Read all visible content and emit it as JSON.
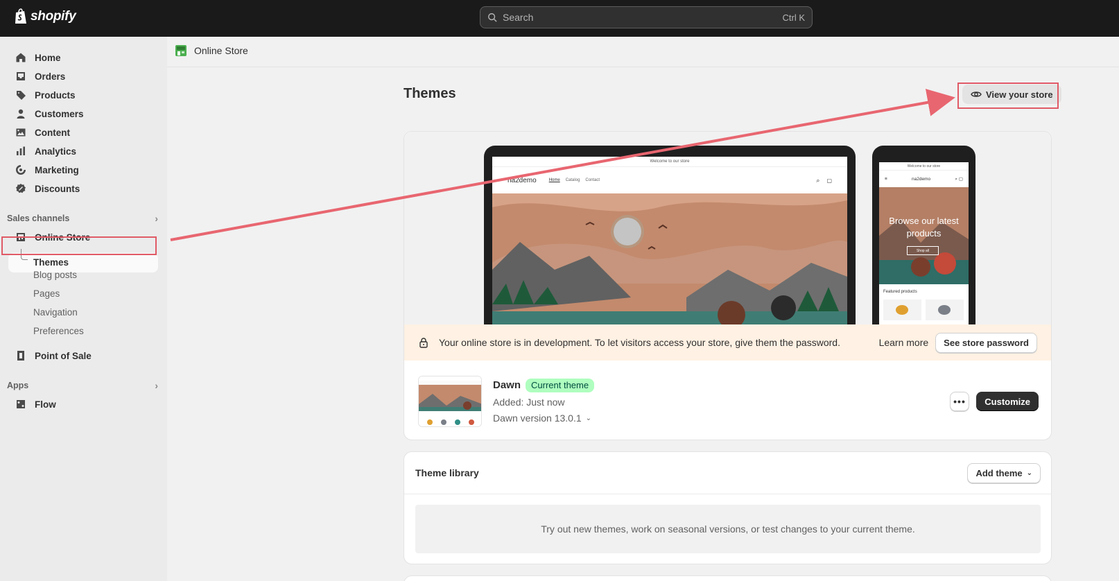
{
  "topbar": {
    "logo_text": "shopify",
    "search_placeholder": "Search",
    "search_shortcut": "Ctrl K"
  },
  "sidebar": {
    "items": [
      {
        "label": "Home",
        "icon": "home-icon"
      },
      {
        "label": "Orders",
        "icon": "inbox-icon"
      },
      {
        "label": "Products",
        "icon": "tag-icon"
      },
      {
        "label": "Customers",
        "icon": "person-icon"
      },
      {
        "label": "Content",
        "icon": "image-icon"
      },
      {
        "label": "Analytics",
        "icon": "bar-chart-icon"
      },
      {
        "label": "Marketing",
        "icon": "target-icon"
      },
      {
        "label": "Discounts",
        "icon": "discount-icon"
      }
    ],
    "sales_channels_label": "Sales channels",
    "online_store_label": "Online Store",
    "online_store_sub": [
      "Themes",
      "Blog posts",
      "Pages",
      "Navigation",
      "Preferences"
    ],
    "point_of_sale_label": "Point of Sale",
    "apps_label": "Apps",
    "flow_label": "Flow"
  },
  "breadcrumb": {
    "label": "Online Store"
  },
  "page": {
    "title": "Themes",
    "view_store_label": "View your store"
  },
  "preview": {
    "laptop": {
      "announcement": "Welcome to our store",
      "store_name": "na2demo",
      "nav": [
        "Home",
        "Catalog",
        "Contact"
      ]
    },
    "phone": {
      "announcement": "Welcome to our store",
      "store_name": "na2demo",
      "hero_text": "Browse our latest products",
      "hero_button": "Shop all",
      "featured_label": "Featured products"
    }
  },
  "notice": {
    "text": "Your online store is in development. To let visitors access your store, give them the password.",
    "learn_more": "Learn more",
    "button": "See store password"
  },
  "current_theme": {
    "name": "Dawn",
    "badge": "Current theme",
    "added": "Added: Just now",
    "version": "Dawn version 13.0.1",
    "more_label": "•••",
    "customize_label": "Customize"
  },
  "library": {
    "title": "Theme library",
    "add_theme_label": "Add theme",
    "empty_text": "Try out new themes, work on seasonal versions, or test changes to your current theme."
  },
  "colors": {
    "topbar": "#1a1a1a",
    "sidebar": "#ebebeb",
    "annotation": "#e05a66",
    "badge_bg": "#affebf",
    "notice_bg": "#fff1e3"
  }
}
